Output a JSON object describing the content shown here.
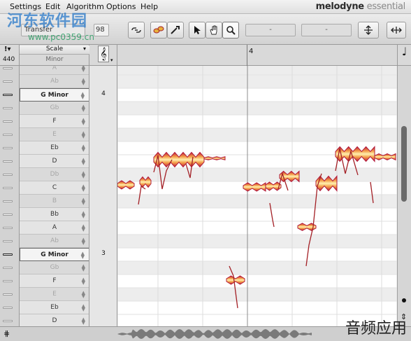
{
  "menu": [
    "Settings",
    "Edit",
    "Algorithm",
    "Options",
    "Help"
  ],
  "brand": {
    "name": "melodyne",
    "edition": " essential"
  },
  "toolbar": {
    "transfer_label": "Transfer",
    "tempo_value": "98",
    "readout_left": "-",
    "readout_right": "-"
  },
  "header": {
    "reference_pitch": "440",
    "scale_label": "Scale",
    "scale_value": "Minor",
    "ruler_marker": "4"
  },
  "scale_rows": [
    {
      "label": "A",
      "kind": "dim"
    },
    {
      "label": "Ab",
      "kind": "dim"
    },
    {
      "label": "G Minor",
      "kind": "key",
      "octave": "4"
    },
    {
      "label": "Gb",
      "kind": "dim"
    },
    {
      "label": "F",
      "kind": "norm"
    },
    {
      "label": "E",
      "kind": "dim"
    },
    {
      "label": "Eb",
      "kind": "norm"
    },
    {
      "label": "D",
      "kind": "norm"
    },
    {
      "label": "Db",
      "kind": "dim"
    },
    {
      "label": "C",
      "kind": "norm"
    },
    {
      "label": "B",
      "kind": "dim"
    },
    {
      "label": "Bb",
      "kind": "norm"
    },
    {
      "label": "A",
      "kind": "norm"
    },
    {
      "label": "Ab",
      "kind": "dim"
    },
    {
      "label": "G Minor",
      "kind": "key",
      "octave": "3"
    },
    {
      "label": "Gb",
      "kind": "dim"
    },
    {
      "label": "F",
      "kind": "norm"
    },
    {
      "label": "E",
      "kind": "dim"
    },
    {
      "label": "Eb",
      "kind": "norm"
    },
    {
      "label": "D",
      "kind": "norm"
    }
  ],
  "watermark": {
    "site_name": "河东软件园",
    "site_url": "www.pc0359.cn",
    "app_caption": "音频应用"
  },
  "colors": {
    "blob_fill": "#f5c45a",
    "blob_edge": "#b0183a",
    "pitch_line": "#a31f25"
  }
}
